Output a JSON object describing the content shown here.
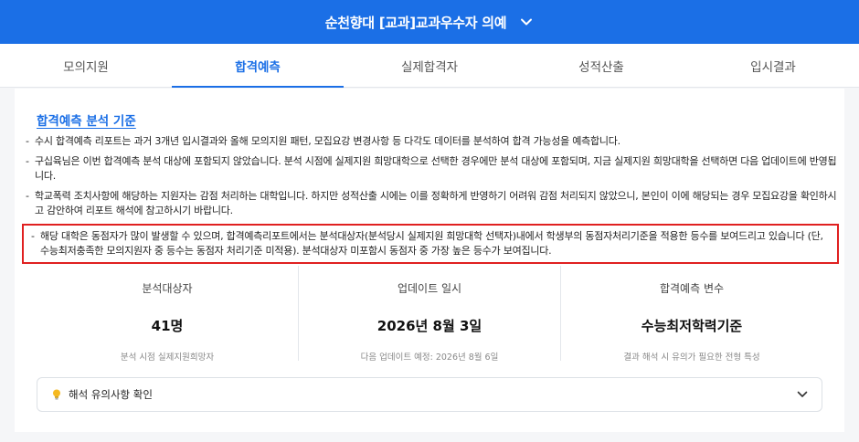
{
  "header": {
    "title": "순천향대 [교과]교과우수자 의예",
    "chevron_icon": "chevron-down-icon"
  },
  "tabs": [
    {
      "label": "모의지원",
      "active": false
    },
    {
      "label": "합격예측",
      "active": true
    },
    {
      "label": "실제합격자",
      "active": false
    },
    {
      "label": "성적산출",
      "active": false
    },
    {
      "label": "입시결과",
      "active": false
    }
  ],
  "criteria": {
    "title": "합격예측 분석 기준",
    "notes": [
      "수시 합격예측 리포트는 과거 3개년 입시결과와 올해 모의지원 패턴, 모집요강 변경사항 등 다각도 데이터를 분석하여 합격 가능성을 예측합니다.",
      "구십육님은 이번 합격예측 분석 대상에 포함되지 않았습니다. 분석 시점에 실제지원 희망대학으로 선택한 경우에만 분석 대상에 포함되며, 지금 실제지원 희망대학을 선택하면 다음 업데이트에 반영됩니다.",
      "학교폭력 조치사항에 해당하는 지원자는 감점 처리하는 대학입니다. 하지만 성적산출 시에는 이를 정확하게 반영하기 어려워 감점 처리되지 않았으니, 본인이 이에 해당되는 경우 모집요강을 확인하시고 감안하여 리포트 해석에 참고하시기 바랍니다.",
      "해당 대학은 동점자가 많이 발생할 수 있으며, 합격예측리포트에서는 분석대상자(분석당시 실제지원 희망대학 선택자)내에서 학생부의 동점자처리기준을 적용한 등수를 보여드리고 있습니다 (단, 수능최저충족한 모의지원자 중 등수는 동점자 처리기준 미적용). 분석대상자 미포함시 동점자 중 가장 높은 등수가 보여집니다."
    ]
  },
  "stats": [
    {
      "label": "분석대상자",
      "value": "41명",
      "sub": "분석 시점 실제지원희망자"
    },
    {
      "label": "업데이트 일시",
      "value": "2026년 8월 3일",
      "sub": "다음 업데이트 예정: 2026년 8월 6일"
    },
    {
      "label": "합격예측 변수",
      "value": "수능최저학력기준",
      "sub": "결과 해석 시 유의가 필요한 전형 특성"
    }
  ],
  "accordion": {
    "label": "해석 유의사항 확인",
    "icon": "lightbulb-icon",
    "chevron_icon": "chevron-down-icon"
  },
  "colors": {
    "primary": "#1b6fe6",
    "highlight_border": "#e02020",
    "bulb": "#f5b921"
  }
}
